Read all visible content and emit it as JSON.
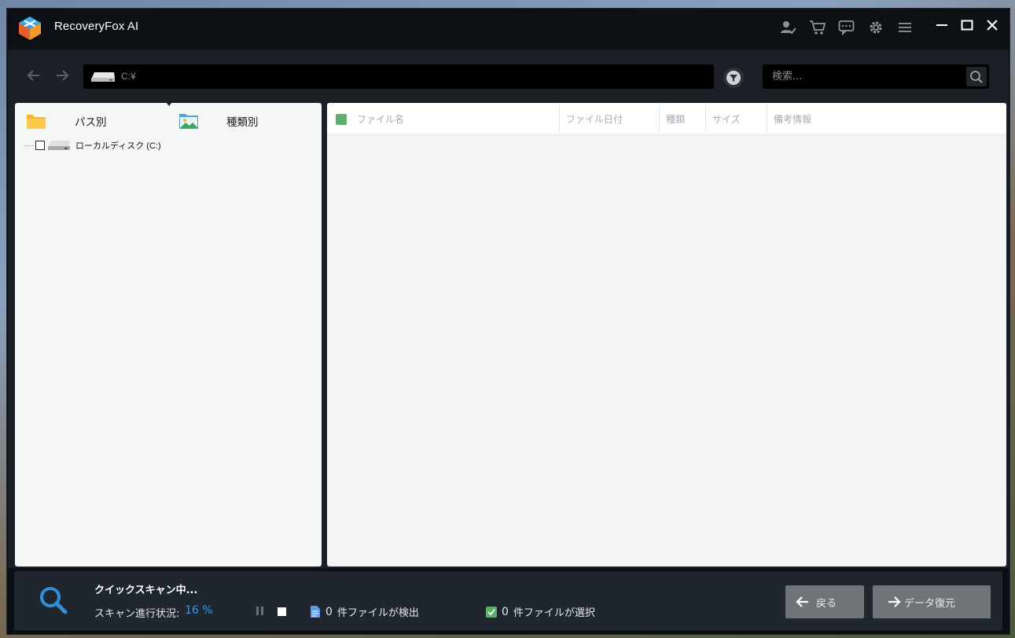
{
  "app": {
    "title": "RecoveryFox AI"
  },
  "toolbar": {
    "path": "C:¥",
    "search_placeholder": "検索..."
  },
  "left_panel": {
    "tabs": [
      {
        "label": "パス別",
        "icon": "folder-icon"
      },
      {
        "label": "種類別",
        "icon": "image-folder-icon"
      }
    ],
    "tree": [
      {
        "label": "ローカルディスク (C:)",
        "icon": "drive-icon",
        "checked": false
      }
    ]
  },
  "file_table": {
    "columns": [
      "ファイル名",
      "ファイル日付",
      "種類",
      "サイズ",
      "備考情報"
    ],
    "rows": []
  },
  "status": {
    "scan_title": "クイックスキャン中...",
    "progress_label": "スキャン進行状況:",
    "progress_value": "16 %",
    "found_count": "0",
    "found_label": "件ファイルが検出",
    "selected_count": "0",
    "selected_label": "件ファイルが選択"
  },
  "buttons": {
    "back": "戻る",
    "recover": "データ復元"
  },
  "colors": {
    "accent": "#2f9bff",
    "check_green": "#5cae6d",
    "window_bg": "#0c1014",
    "panel_bg": "#1a2026"
  }
}
